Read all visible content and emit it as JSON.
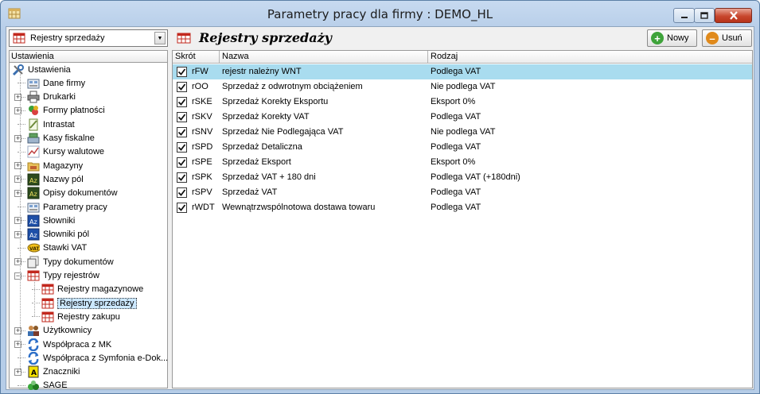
{
  "window": {
    "title": "Parametry pracy dla firmy : DEMO_HL"
  },
  "sidebar": {
    "combo_value": "Rejestry sprzedaży",
    "header": "Ustawienia",
    "items": [
      {
        "label": "Ustawienia",
        "icon": "tools-icon"
      },
      {
        "label": "Dane firmy",
        "icon": "company-icon"
      },
      {
        "label": "Drukarki",
        "icon": "printer-icon"
      },
      {
        "label": "Formy płatności",
        "icon": "payment-icon"
      },
      {
        "label": "Intrastat",
        "icon": "document-icon"
      },
      {
        "label": "Kasy fiskalne",
        "icon": "cash-register-icon"
      },
      {
        "label": "Kursy walutowe",
        "icon": "currency-chart-icon"
      },
      {
        "label": "Magazyny",
        "icon": "folder-icon"
      },
      {
        "label": "Nazwy pól",
        "icon": "az-icon"
      },
      {
        "label": "Opisy dokumentów",
        "icon": "az-icon"
      },
      {
        "label": "Parametry pracy",
        "icon": "company-icon"
      },
      {
        "label": "Słowniki",
        "icon": "az-blue-icon"
      },
      {
        "label": "Słowniki pól",
        "icon": "az-blue-icon"
      },
      {
        "label": "Stawki VAT",
        "icon": "vat-icon"
      },
      {
        "label": "Typy dokumentów",
        "icon": "document-types-icon"
      },
      {
        "label": "Typy rejestrów",
        "icon": "register-icon"
      },
      {
        "label": "Rejestry magazynowe",
        "icon": "register-icon"
      },
      {
        "label": "Rejestry sprzedaży",
        "icon": "register-icon"
      },
      {
        "label": "Rejestry zakupu",
        "icon": "register-icon"
      },
      {
        "label": "Użytkownicy",
        "icon": "users-icon"
      },
      {
        "label": "Współpraca z MK",
        "icon": "sync-icon"
      },
      {
        "label": "Współpraca z Symfonia e-Dok...",
        "icon": "sync-icon"
      },
      {
        "label": "Znaczniki",
        "icon": "marker-icon"
      },
      {
        "label": "SAGE",
        "icon": "sage-icon"
      }
    ]
  },
  "main": {
    "title": "Rejestry sprzedaży",
    "new_label": "Nowy",
    "delete_label": "Usuń",
    "columns": [
      "Skrót",
      "Nazwa",
      "Rodzaj"
    ],
    "rows": [
      {
        "code": "rFW",
        "name": "rejestr należny WNT",
        "type": "Podlega VAT"
      },
      {
        "code": "rOO",
        "name": "Sprzedaż z odwrotnym obciążeniem",
        "type": "Nie podlega VAT"
      },
      {
        "code": "rSKE",
        "name": "Sprzedaż Korekty Eksportu",
        "type": "Eksport 0%"
      },
      {
        "code": "rSKV",
        "name": "Sprzedaż Korekty VAT",
        "type": "Podlega VAT"
      },
      {
        "code": "rSNV",
        "name": "Sprzedaż Nie Podlegająca VAT",
        "type": "Nie podlega VAT"
      },
      {
        "code": "rSPD",
        "name": "Sprzedaż Detaliczna",
        "type": "Podlega VAT"
      },
      {
        "code": "rSPE",
        "name": "Sprzedaż Eksport",
        "type": "Eksport 0%"
      },
      {
        "code": "rSPK",
        "name": "Sprzedaż VAT + 180 dni",
        "type": "Podlega VAT (+180dni)"
      },
      {
        "code": "rSPV",
        "name": "Sprzedaż VAT",
        "type": "Podlega VAT"
      },
      {
        "code": "rWDT",
        "name": "Wewnątrzwspólnotowa dostawa towaru",
        "type": "Podlega VAT"
      }
    ]
  },
  "colors": {
    "selected_row": "#a9dcef",
    "tree_selection": "#cce8ff",
    "new_button": "#3ea33a",
    "delete_button": "#e08a1c"
  }
}
